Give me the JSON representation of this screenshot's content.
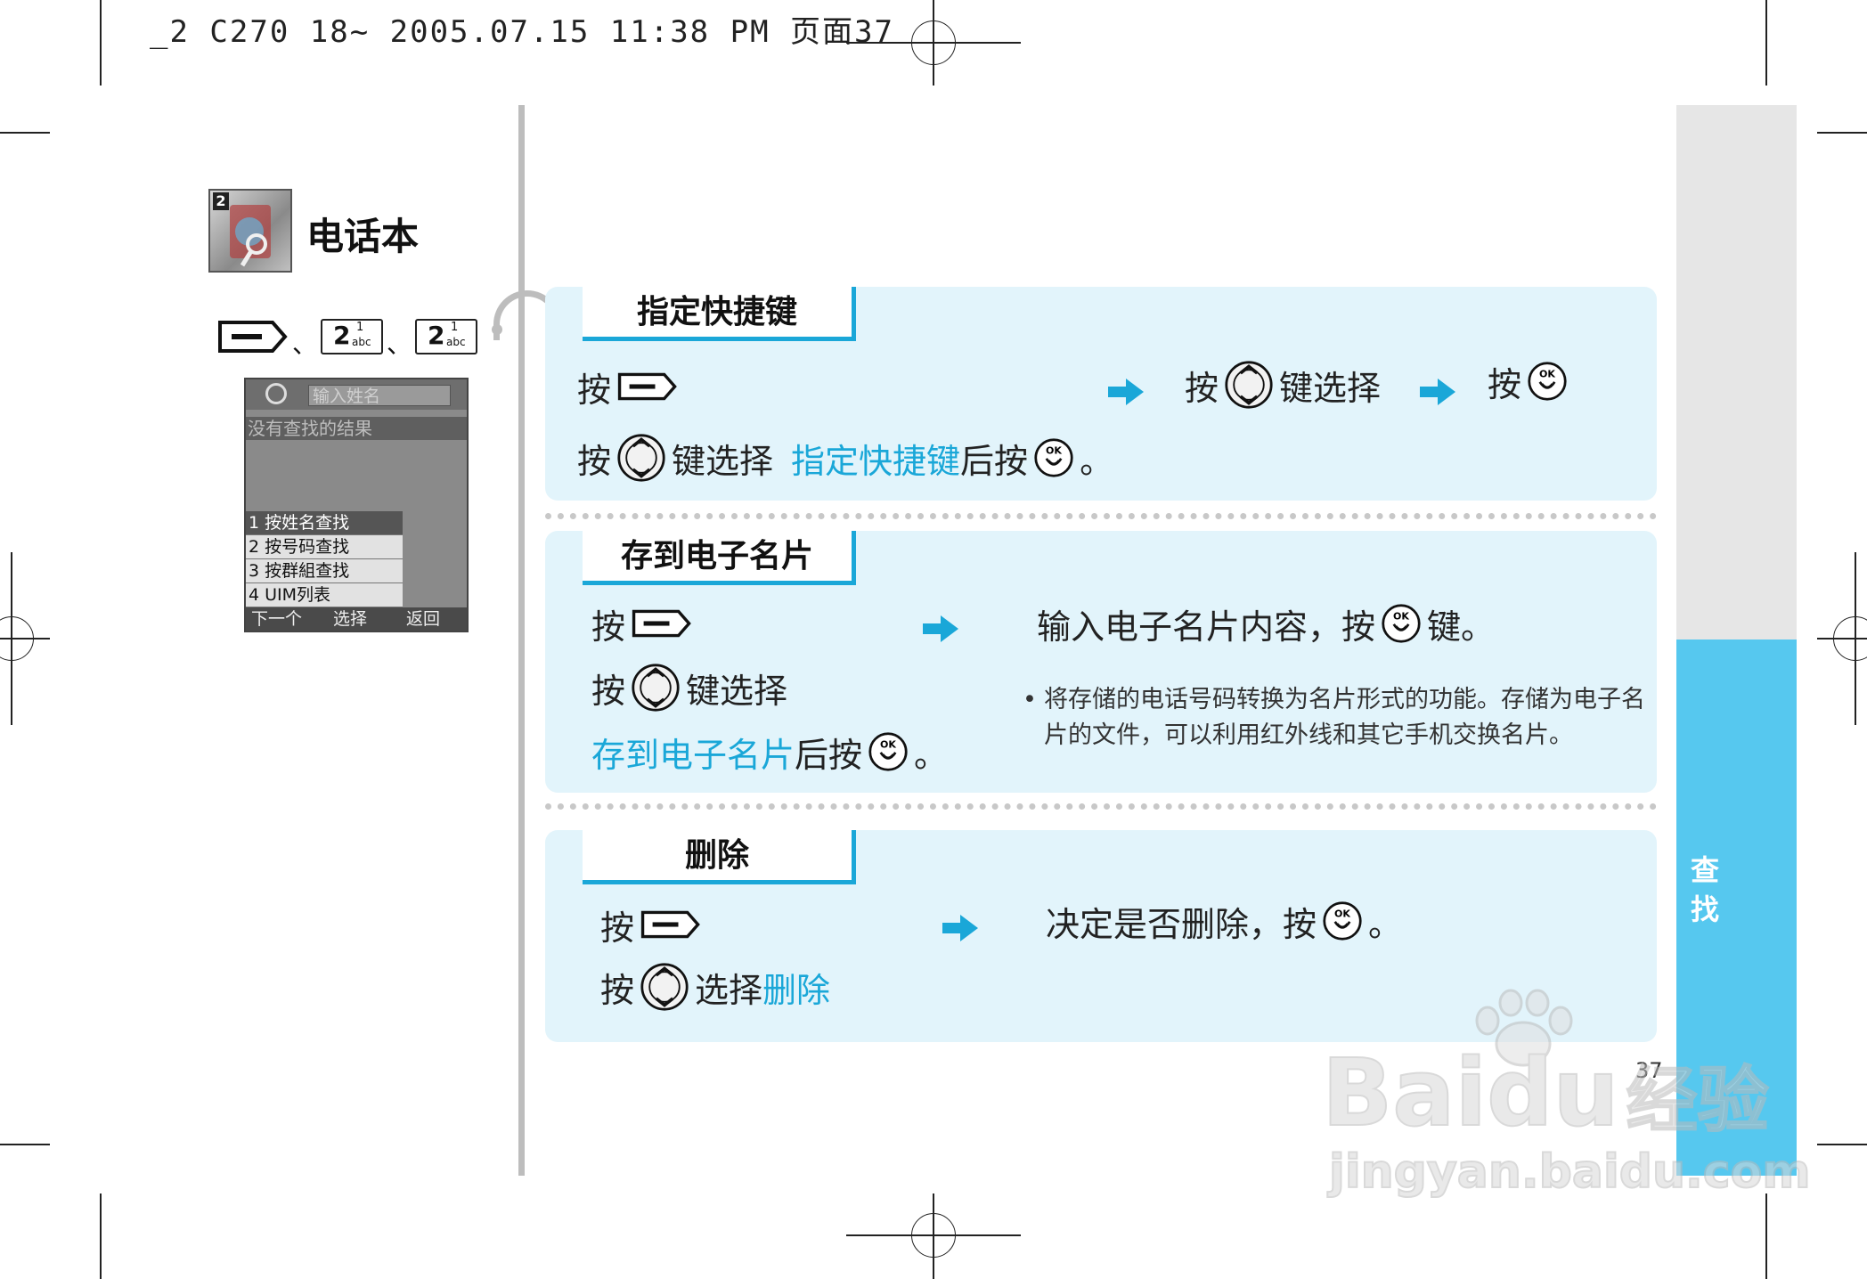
{
  "header": {
    "print_info": "_2 C270 18~ 2005.07.15 11:38 PM 页面37"
  },
  "chapter": {
    "number": "2",
    "title": "电话本"
  },
  "key_sequence": {
    "separator": "、",
    "key_digit": "2",
    "key_sup": "1",
    "key_sub": "abc"
  },
  "phone_screen": {
    "search_placeholder": "输入姓名",
    "no_result": "没有查找的结果",
    "menu": [
      "1 按姓名查找",
      "2 按号码查找",
      "3 按群組查找",
      "4 UIM列表"
    ],
    "soft_left": "下一个",
    "soft_center": "选择",
    "soft_right": "返回"
  },
  "sections": {
    "assign_shortcut": {
      "title": "指定快捷键",
      "press": "按",
      "select_with_key": "键选择",
      "line2_suffix": "键选择",
      "highlight": "指定快捷键",
      "after_press": "后按",
      "period": "。"
    },
    "save_card": {
      "title": "存到电子名片",
      "press": "按",
      "select_with_key": "键选择",
      "highlight": "存到电子名片",
      "after_press": "后按",
      "period": "。",
      "result_text": "输入电子名片内容，按",
      "result_suffix": "键。",
      "note_bullet": "•",
      "note_line1": "将存储的电话号码转换为名片形式的功能。存储为电子名",
      "note_line2": "片的文件，可以利用红外线和其它手机交换名片。"
    },
    "delete": {
      "title": "删除",
      "press": "按",
      "select": "选择",
      "highlight": "删除",
      "result_text": "决定是否删除，按",
      "period": "。"
    }
  },
  "sidebar": {
    "tab_line1": "查",
    "tab_line2": "找"
  },
  "page_number": "37",
  "watermark": {
    "brand": "Bai",
    "brand2": "du",
    "suffix": "经验",
    "url": "jingyan.baidu.com"
  },
  "colors": {
    "accent": "#1aa7d8",
    "panel": "#e2f4fb",
    "sidebar_blue": "#56c8ef",
    "sidebar_gray": "#e6e6e6"
  },
  "icons": {
    "softkey": "left-softkey-icon",
    "nav": "nav-updown-icon",
    "ok": "ok-key-icon",
    "arrow": "right-arrow-icon"
  }
}
